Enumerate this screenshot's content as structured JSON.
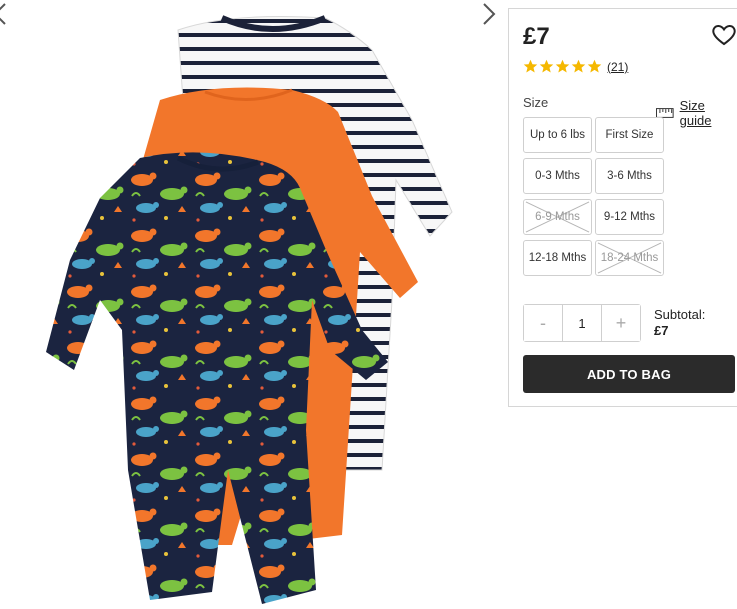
{
  "product": {
    "price": "£7",
    "rating": {
      "stars": 5,
      "review_count": "(21)"
    }
  },
  "size_selector": {
    "label": "Size",
    "guide_label": "Size guide",
    "options": [
      {
        "label": "Up to 6 lbs",
        "available": true
      },
      {
        "label": "First Size",
        "available": true
      },
      {
        "label": "0-3 Mths",
        "available": true
      },
      {
        "label": "3-6 Mths",
        "available": true
      },
      {
        "label": "6-9 Mths",
        "available": false
      },
      {
        "label": "9-12 Mths",
        "available": true
      },
      {
        "label": "12-18 Mths",
        "available": true
      },
      {
        "label": "18-24 Mths",
        "available": false
      }
    ]
  },
  "quantity": {
    "minus": "-",
    "value": "1",
    "plus": "+"
  },
  "subtotal": {
    "label": "Subtotal:",
    "value": "£7"
  },
  "add_to_bag": "ADD TO BAG",
  "icons": {
    "wishlist": "heart-outline-icon",
    "star": "star-icon",
    "size_guide": "ruler-icon",
    "next": "chevron-right-icon",
    "prev": "chevron-left-icon"
  },
  "colors": {
    "star": "#f5b800",
    "button_bg": "#2b2b2b",
    "orange": "#f2762b",
    "navy": "#1b2440"
  }
}
